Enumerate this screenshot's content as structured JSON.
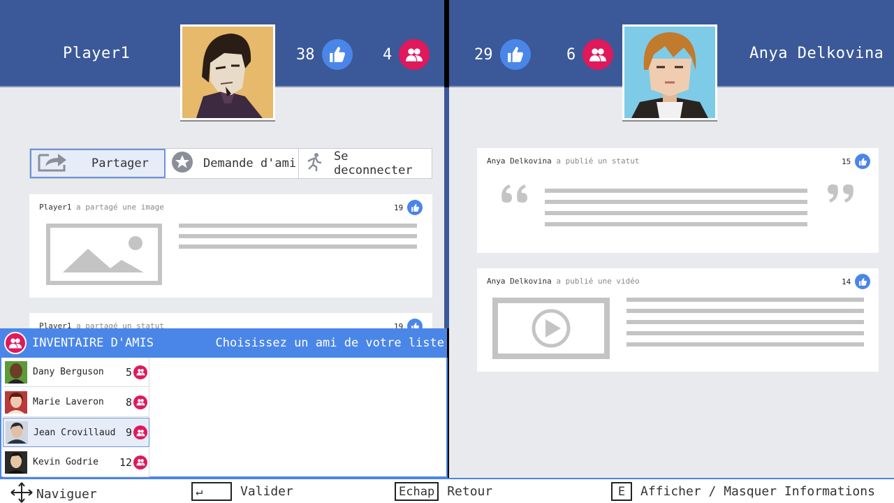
{
  "left_player": {
    "name": "Player1",
    "likes": "38",
    "friends": "4",
    "actions": [
      {
        "label": "Partager",
        "icon": "share-icon"
      },
      {
        "label": "Demande d'ami",
        "icon": "star-icon"
      },
      {
        "label": "Se deconnecter",
        "icon": "running-person-icon"
      }
    ],
    "posts": [
      {
        "author": "Player1",
        "verb": "a partagé une image",
        "likes": "19",
        "type": "image"
      },
      {
        "author": "Player1",
        "verb": "a partagé un statut",
        "likes": "19",
        "type": "status"
      }
    ]
  },
  "right_player": {
    "name": "Anya Delkovina",
    "likes": "29",
    "friends": "6",
    "posts": [
      {
        "author": "Anya Delkovina",
        "verb": "a publié un statut",
        "likes": "15",
        "type": "quote"
      },
      {
        "author": "Anya Delkovina",
        "verb": "a publié une vidéo",
        "likes": "14",
        "type": "video"
      }
    ]
  },
  "inventory": {
    "title": "INVENTAIRE D'AMIS",
    "hint": "Choisissez un ami de votre liste",
    "friends": [
      {
        "name": "Dany Berguson",
        "count": "5"
      },
      {
        "name": "Marie Laveron",
        "count": "8"
      },
      {
        "name": "Jean Crovillaud",
        "count": "9",
        "selected": true
      },
      {
        "name": "Kevin Godrie",
        "count": "12"
      }
    ]
  },
  "footer": {
    "navigate": "Naviguer",
    "validate_key": "↵",
    "validate": "Valider",
    "escape_key": "Echap",
    "back": "Retour",
    "info_key": "E",
    "info": "Afficher / Masquer Informations"
  },
  "colors": {
    "banner": "#3b5998",
    "like": "#4a86e8",
    "friend": "#e0185c",
    "background": "#e9eaee"
  }
}
